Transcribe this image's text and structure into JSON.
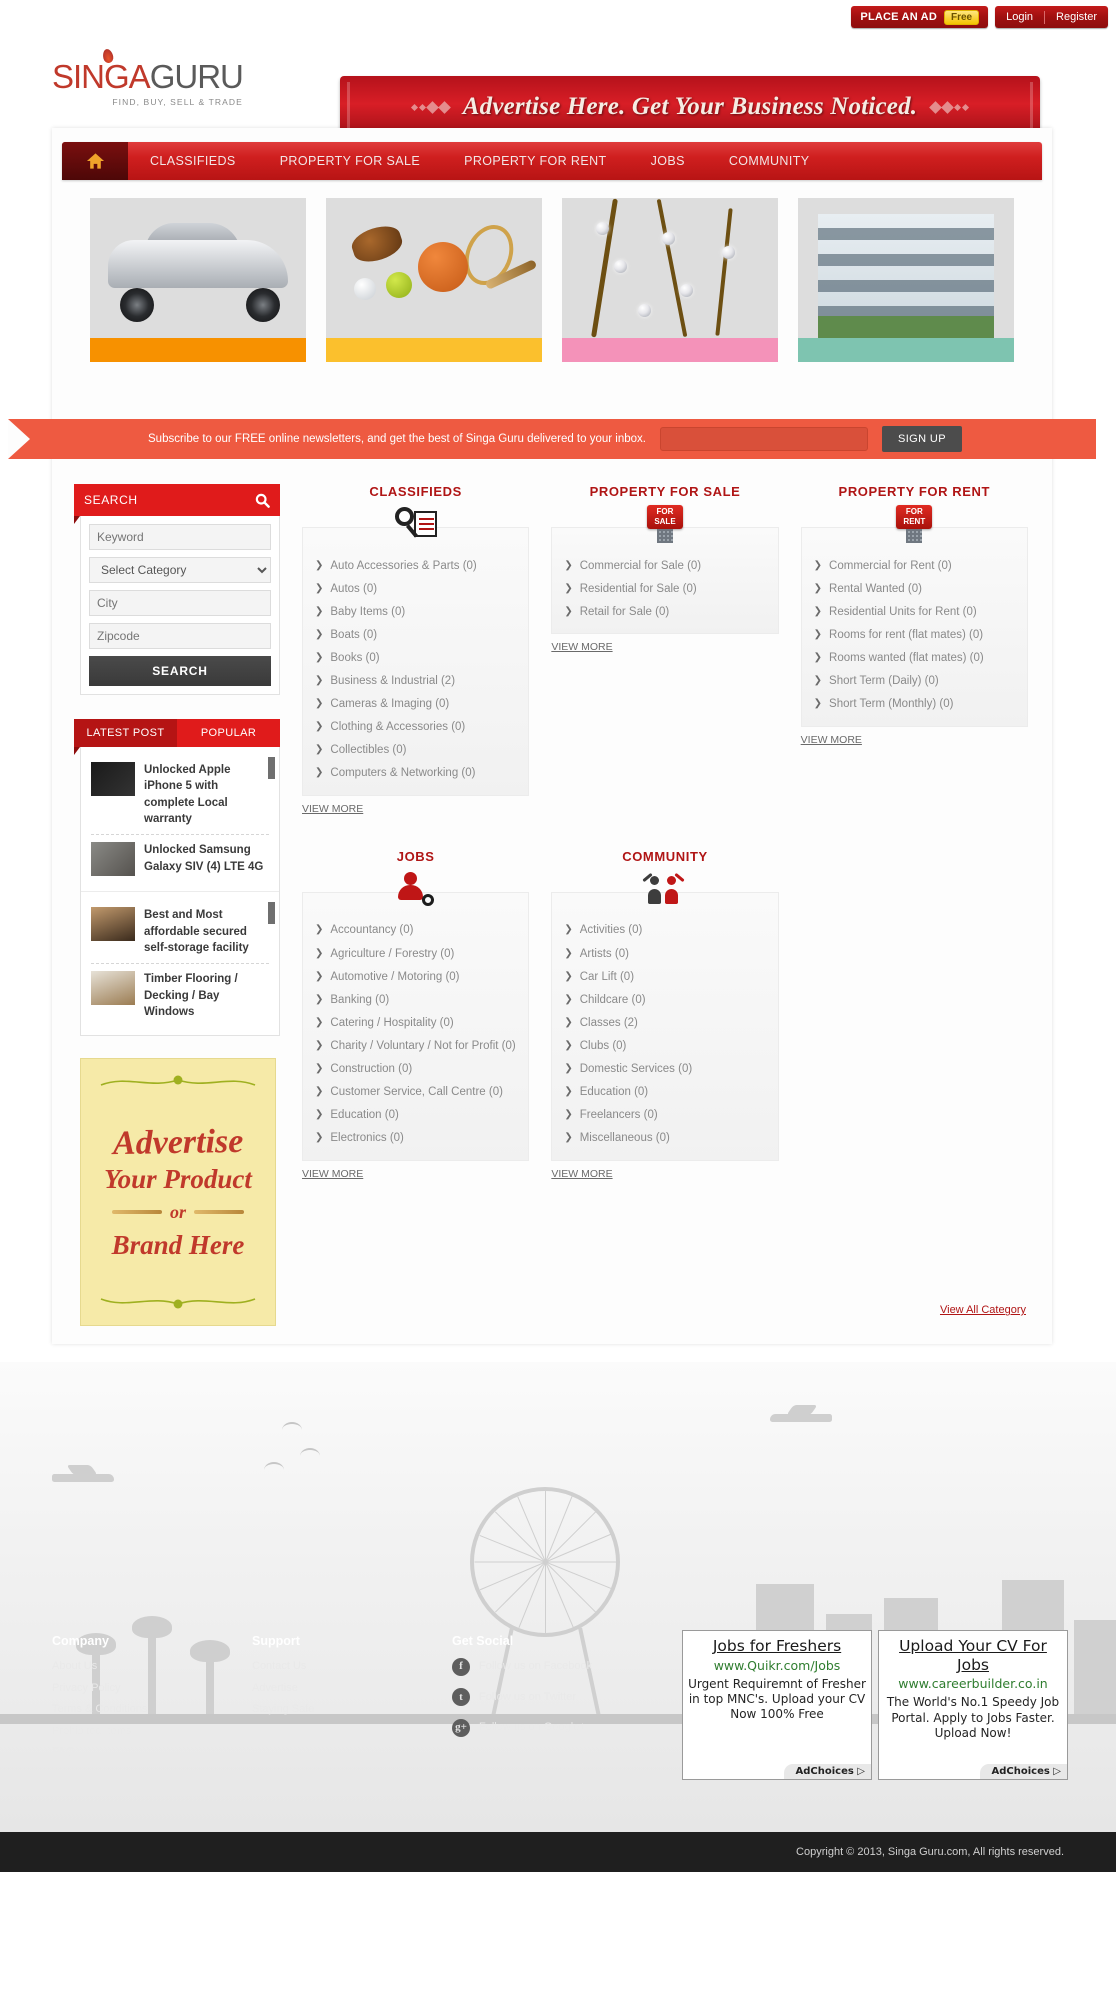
{
  "header": {
    "logo_primary": "SINGA",
    "logo_secondary": "GURU",
    "logo_tagline": "FIND, BUY, SELL & TRADE",
    "place_ad_label": "PLACE AN AD",
    "free_badge": "Free",
    "login_label": "Login",
    "register_label": "Register",
    "ad_banner_text": "Advertise Here. Get Your Business Noticed."
  },
  "nav": {
    "home_icon": "home-icon",
    "items": [
      {
        "label": "CLASSIFIEDS"
      },
      {
        "label": "PROPERTY FOR SALE"
      },
      {
        "label": "PROPERTY FOR RENT"
      },
      {
        "label": "JOBS"
      },
      {
        "label": "COMMUNITY"
      }
    ]
  },
  "slider": {
    "prev_arrow": "‹",
    "next_arrow": "›",
    "slides": [
      {
        "name": "autos-slide",
        "bar_color": "#f79100"
      },
      {
        "name": "sports-slide",
        "bar_color": "#fbc02d"
      },
      {
        "name": "jewellery-slide",
        "bar_color": "#f492b9"
      },
      {
        "name": "property-slide",
        "bar_color": "#7ec4b0"
      }
    ]
  },
  "newsletter": {
    "text": "Subscribe to our FREE online newsletters, and get the best of Singa Guru delivered to your inbox.",
    "input_placeholder": "",
    "input_value": "",
    "signup_label": "SIGN UP"
  },
  "search_panel": {
    "title": "SEARCH",
    "icon": "search-icon",
    "keyword_placeholder": "Keyword",
    "keyword_value": "",
    "category_selected": "Select Category",
    "city_placeholder": "City",
    "city_value": "",
    "zipcode_placeholder": "Zipcode",
    "zipcode_value": "",
    "search_button": "SEARCH"
  },
  "posts_panel": {
    "tab_latest": "LATEST POST",
    "tab_popular": "POPULAR",
    "groups": [
      {
        "items": [
          {
            "title": "Unlocked Apple iPhone 5 with complete Local warranty"
          },
          {
            "title": "Unlocked Samsung Galaxy SIV (4) LTE 4G"
          }
        ]
      },
      {
        "items": [
          {
            "title": "Best and Most affordable secured self-storage facility"
          },
          {
            "title": "Timber Flooring / Decking / Bay Windows"
          }
        ]
      }
    ]
  },
  "poster": {
    "line1": "Advertise",
    "line2": "Your Product",
    "line3": "or",
    "line4": "Brand Here"
  },
  "categories": {
    "view_more_label": "VIEW MORE",
    "view_all_label": "View All Category",
    "columns": [
      {
        "title": "CLASSIFIEDS",
        "icon": "classified-icon",
        "items": [
          "Auto Accessories & Parts (0)",
          "Autos (0)",
          "Baby Items (0)",
          "Boats (0)",
          "Books (0)",
          "Business & Industrial (2)",
          "Cameras & Imaging (0)",
          "Clothing & Accessories (0)",
          "Collectibles (0)",
          "Computers & Networking (0)"
        ]
      },
      {
        "title": "PROPERTY FOR SALE",
        "icon": "for-sale-sign-icon",
        "items": [
          "Commercial for Sale (0)",
          "Residential for Sale (0)",
          "Retail for Sale (0)"
        ]
      },
      {
        "title": "PROPERTY FOR RENT",
        "icon": "for-rent-sign-icon",
        "items": [
          "Commercial for Rent (0)",
          "Rental Wanted (0)",
          "Residential Units for Rent (0)",
          "Rooms for rent (flat mates) (0)",
          "Rooms wanted (flat mates) (0)",
          "Short Term (Daily) (0)",
          "Short Term (Monthly) (0)"
        ]
      },
      {
        "title": "JOBS",
        "icon": "job-search-icon",
        "items": [
          "Accountancy (0)",
          "Agriculture / Forestry (0)",
          "Automotive / Motoring (0)",
          "Banking (0)",
          "Catering / Hospitality (0)",
          "Charity / Voluntary / Not for Profit (0)",
          "Construction (0)",
          "Customer Service, Call Centre (0)",
          "Education (0)",
          "Electronics (0)"
        ]
      },
      {
        "title": "COMMUNITY",
        "icon": "people-icon",
        "items": [
          "Activities (0)",
          "Artists (0)",
          "Car Lift (0)",
          "Childcare (0)",
          "Classes (2)",
          "Clubs (0)",
          "Domestic Services (0)",
          "Education (0)",
          "Freelancers (0)",
          "Miscellaneous (0)"
        ]
      }
    ]
  },
  "footer": {
    "company": {
      "heading": "Company",
      "links": [
        "About Us",
        "Privacy Policy",
        "Terms & Conditions",
        "Prohibited Items",
        "FAQ"
      ]
    },
    "support": {
      "heading": "Support",
      "links": [
        "Contact Us",
        "Advertise",
        "Staying Safe"
      ]
    },
    "social": {
      "heading": "Get Social",
      "links": [
        {
          "glyph": "f",
          "icon": "facebook-icon",
          "label": "Follow us on Facebook"
        },
        {
          "glyph": "t",
          "icon": "twitter-icon",
          "label": "Follow us on Twitter"
        },
        {
          "glyph": "g+",
          "icon": "google-plus-icon",
          "label": "Follow us on Google+"
        }
      ]
    },
    "ads": [
      {
        "headline": "Jobs for Freshers",
        "url": "www.Quikr.com/Jobs",
        "description": "Urgent Requiremnt of Fresher in top MNC's. Upload your CV Now 100% Free",
        "adchoices": "AdChoices ▷"
      },
      {
        "headline": "Upload Your CV For Jobs",
        "url": "www.careerbuilder.co.in",
        "description": "The World's No.1 Speedy Job Portal. Apply to Jobs Faster. Upload Now!",
        "adchoices": "AdChoices ▷"
      }
    ],
    "copyright": "Copyright © 2013, Singa Guru.com, All rights reserved."
  }
}
